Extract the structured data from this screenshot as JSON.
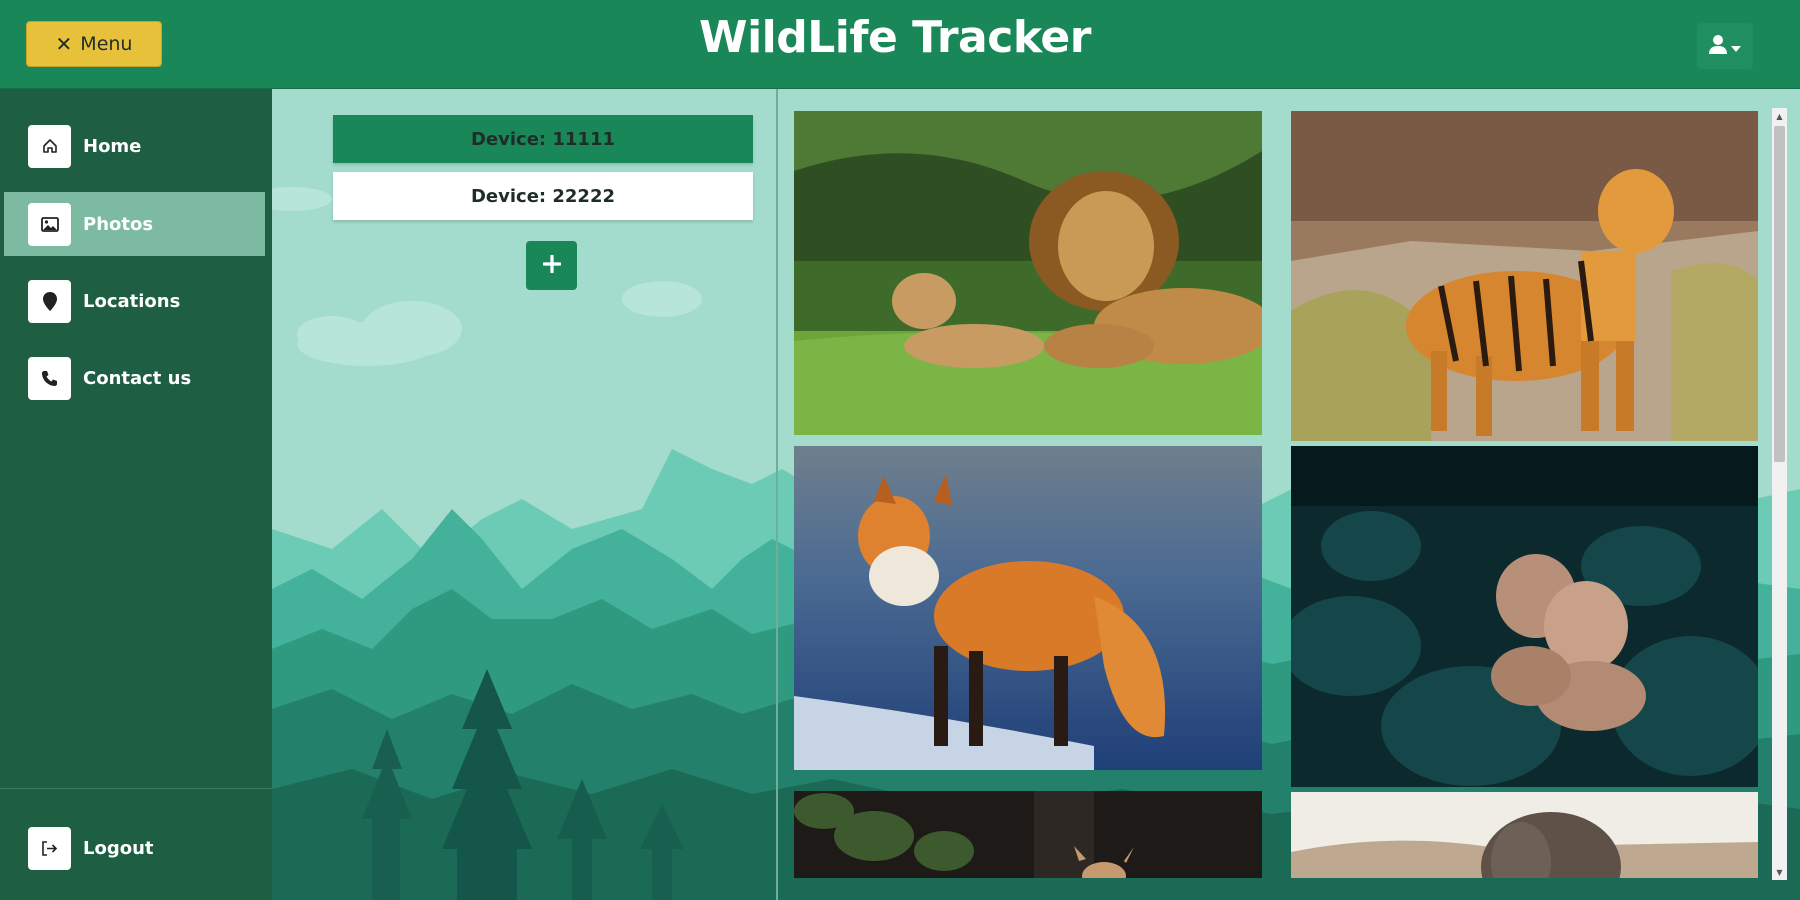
{
  "header": {
    "menu_label": "Menu",
    "menu_icon": "close-icon",
    "title": "WildLife Tracker",
    "user_icon": "user-icon"
  },
  "sidebar": {
    "items": [
      {
        "label": "Home",
        "icon": "home-icon",
        "active": false
      },
      {
        "label": "Photos",
        "icon": "image-icon",
        "active": true
      },
      {
        "label": "Locations",
        "icon": "map-pin-icon",
        "active": false
      },
      {
        "label": "Contact us",
        "icon": "phone-icon",
        "active": false
      }
    ],
    "logout_label": "Logout",
    "logout_icon": "logout-icon"
  },
  "devices": {
    "items": [
      {
        "label": "Device: 11111",
        "selected": true
      },
      {
        "label": "Device: 22222",
        "selected": false
      }
    ],
    "add_icon": "plus-icon"
  },
  "photos": [
    {
      "subject": "lion-with-cub"
    },
    {
      "subject": "tiger"
    },
    {
      "subject": "red-fox"
    },
    {
      "subject": "lionesses"
    },
    {
      "subject": "deer"
    },
    {
      "subject": "elephant"
    }
  ],
  "colors": {
    "header": "#1a8758",
    "sidebar": "#1e5e42",
    "active_nav": "#7cbaa2",
    "menu_button": "#e8c13a",
    "background": "#a3dccc"
  }
}
